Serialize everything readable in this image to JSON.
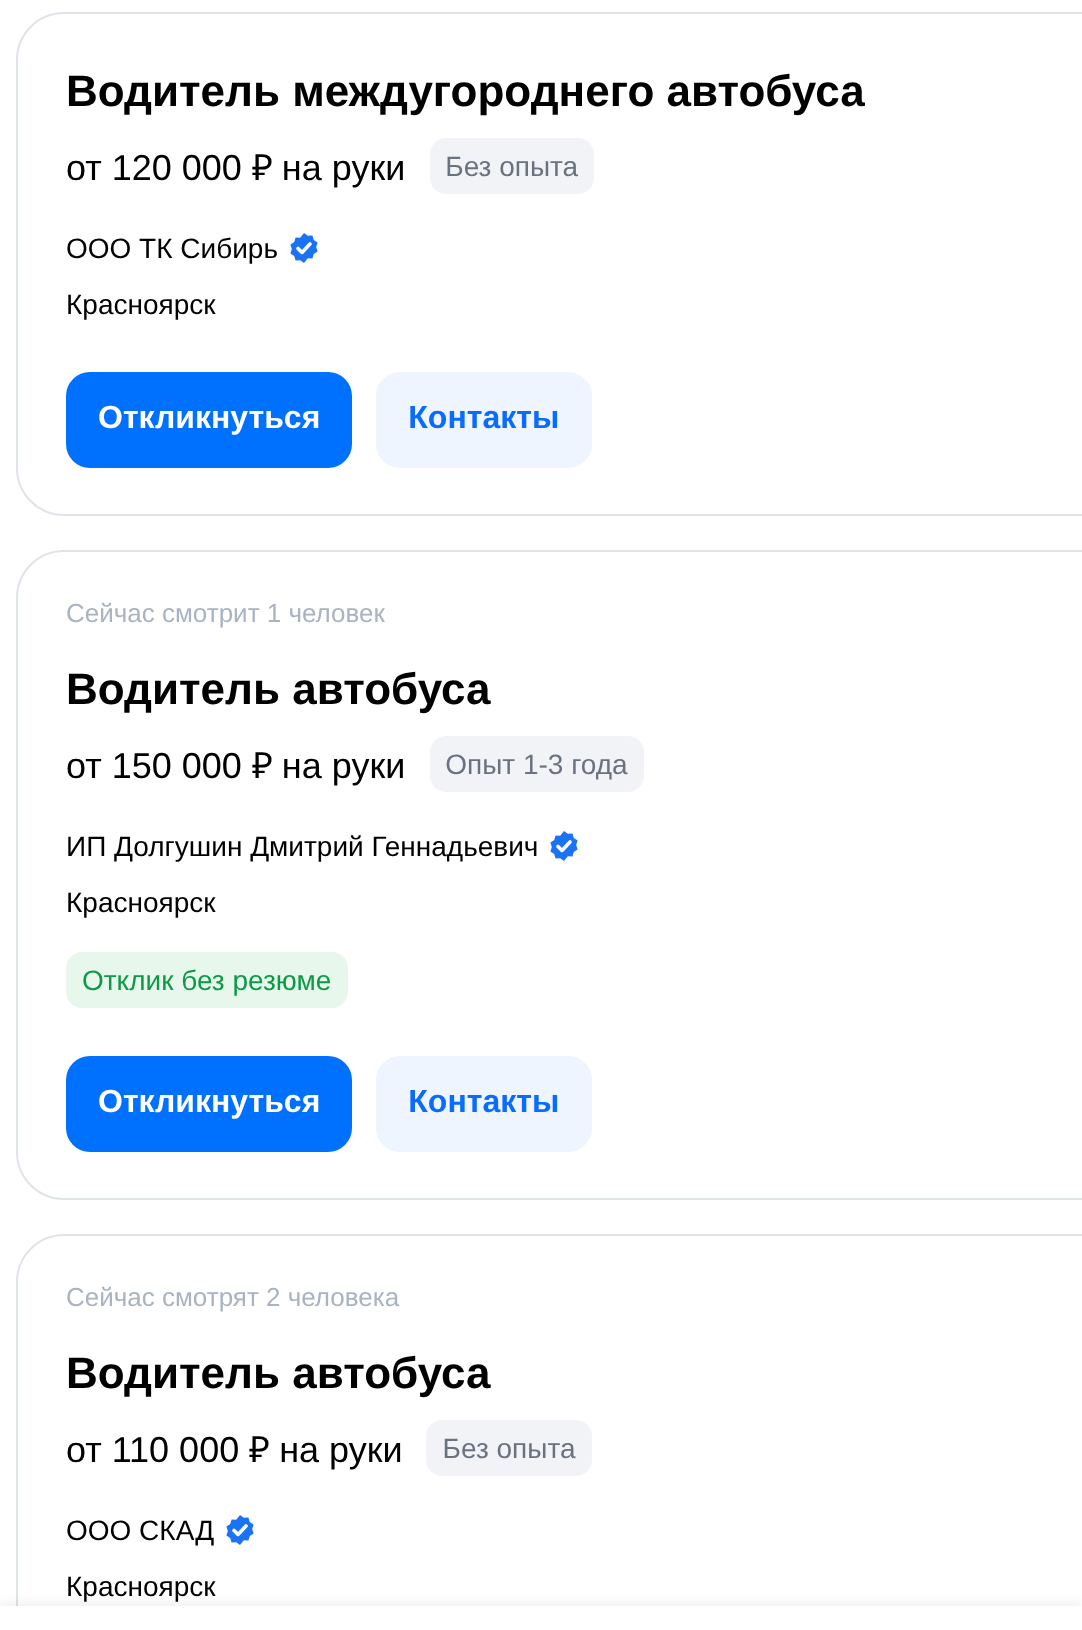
{
  "vacancies": [
    {
      "title": "Водитель междугороднего автобуса",
      "salary": "от 120 000 ₽ на руки",
      "experience": "Без опыта",
      "company": "ООО ТК Сибирь",
      "verified": true,
      "city": "Красноярск",
      "buttons": [
        {
          "label": "Откликнуться",
          "kind": "primary"
        },
        {
          "label": "Контакты",
          "kind": "secondary"
        }
      ]
    },
    {
      "viewers": "Сейчас смотрит 1 человек",
      "title": "Водитель автобуса",
      "salary": "от 150 000 ₽ на руки",
      "experience": "Опыт 1-3 года",
      "company": "ИП Долгушин Дмитрий Геннадьевич",
      "verified": true,
      "city": "Красноярск",
      "tag": "Отклик без резюме",
      "buttons": [
        {
          "label": "Откликнуться",
          "kind": "primary"
        },
        {
          "label": "Контакты",
          "kind": "secondary"
        }
      ]
    },
    {
      "viewers": "Сейчас смотрят 2 человека",
      "title": "Водитель автобуса",
      "salary": "от 110 000 ₽ на руки",
      "experience": "Без опыта",
      "company": "ООО СКАД",
      "verified": true,
      "city": "Красноярск"
    }
  ]
}
